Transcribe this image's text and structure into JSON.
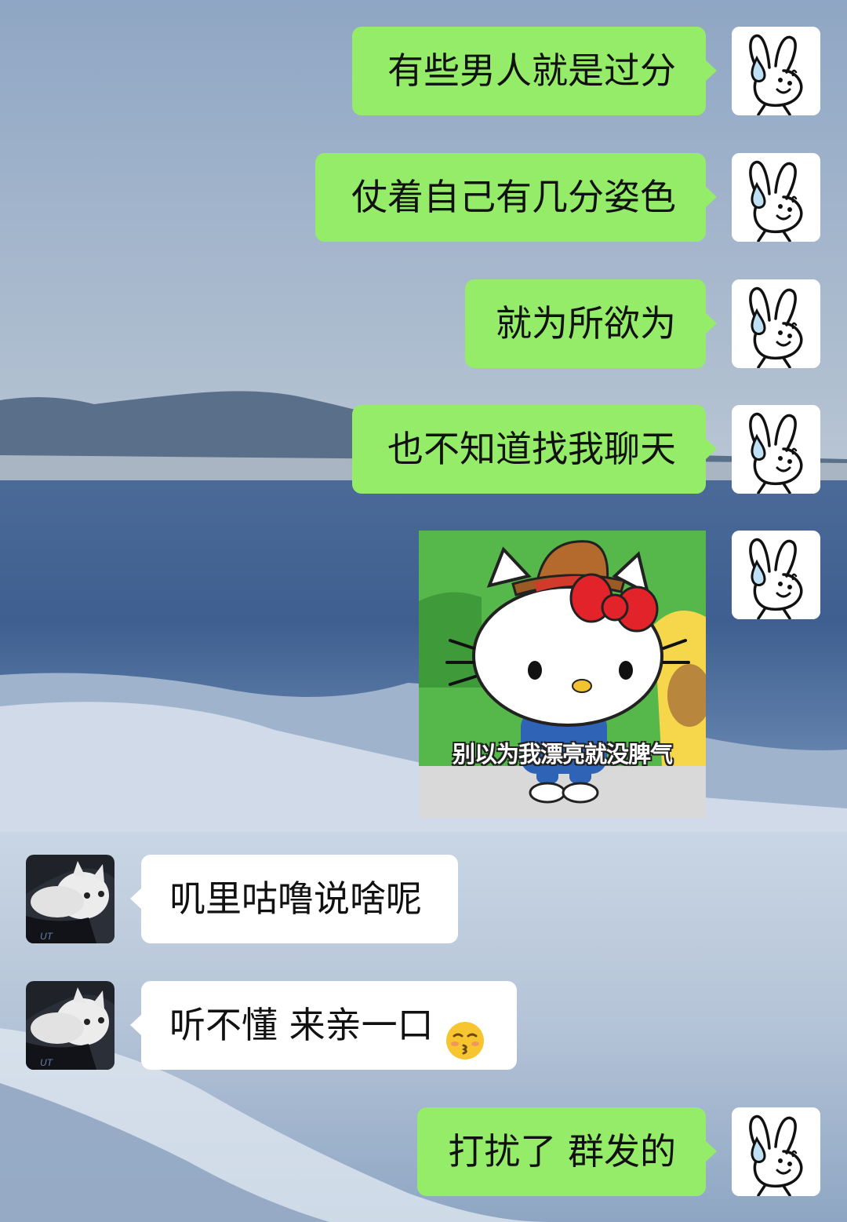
{
  "chat": {
    "messages": [
      {
        "side": "out",
        "text": "有些男人就是过分"
      },
      {
        "side": "out",
        "text": "仗着自己有几分姿色"
      },
      {
        "side": "out",
        "text": "就为所欲为"
      },
      {
        "side": "out",
        "text": "也不知道找我聊天"
      },
      {
        "side": "out",
        "type": "sticker",
        "caption": "别以为我漂亮就没脾气"
      },
      {
        "side": "in",
        "text": "叽里咕噜说啥呢"
      },
      {
        "side": "in",
        "text": "听不懂 来亲一口",
        "emoji": "kissing-face-emoji"
      },
      {
        "side": "out",
        "text": "打扰了 群发的"
      }
    ]
  },
  "colors": {
    "outgoing_bubble": "#95ec69",
    "incoming_bubble": "#ffffff"
  },
  "icons": {
    "self_avatar": "rabbit-drawing-avatar",
    "other_avatar": "white-cat-photo-avatar"
  }
}
